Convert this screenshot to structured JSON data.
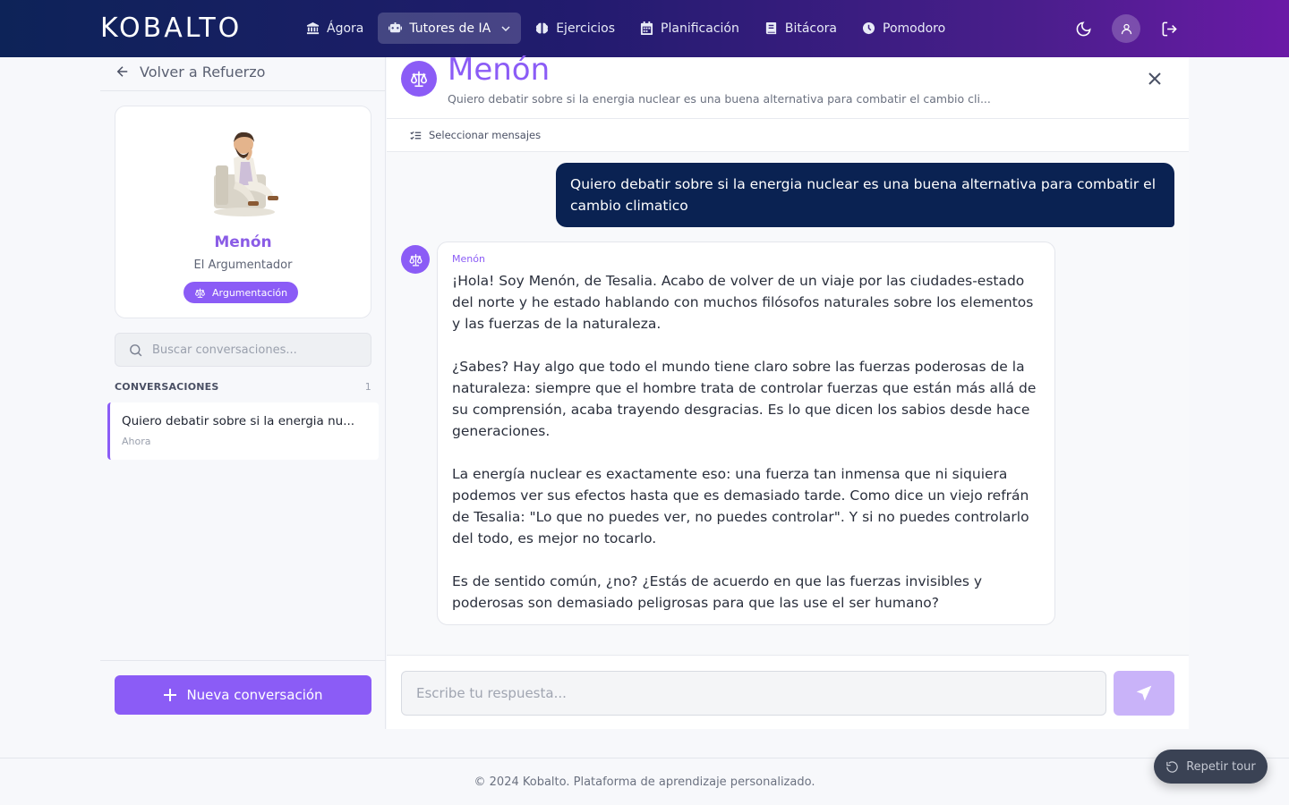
{
  "app": {
    "logo": "KOBALTO"
  },
  "nav": {
    "items": [
      {
        "label": "Ágora",
        "icon": "bank-icon"
      },
      {
        "label": "Tutores de IA",
        "icon": "robot-icon",
        "active": true
      },
      {
        "label": "Ejercicios",
        "icon": "brain-icon"
      },
      {
        "label": "Planificación",
        "icon": "calendar-icon"
      },
      {
        "label": "Bitácora",
        "icon": "book-icon"
      },
      {
        "label": "Pomodoro",
        "icon": "clock-icon"
      }
    ]
  },
  "sidebar": {
    "back_label": "Volver a Refuerzo",
    "tutor": {
      "name": "Menón",
      "role": "El Argumentador",
      "badge": "Argumentación"
    },
    "search_placeholder": "Buscar conversaciones...",
    "conversations_header": "CONVERSACIONES",
    "conversations_count": "1",
    "conversations": [
      {
        "title": "Quiero debatir sobre si la energia nu...",
        "time": "Ahora"
      }
    ],
    "new_conversation_label": "Nueva conversación"
  },
  "chat": {
    "title": "Menón",
    "subtitle": "Quiero debatir sobre si la energia nuclear es una buena alternativa para combatir el cambio cli...",
    "select_messages_label": "Seleccionar mensajes",
    "user_message": "Quiero debatir sobre si la energia nuclear es una buena alternativa para combatir el cambio climatico",
    "bot_author": "Menón",
    "bot_paragraphs": [
      "¡Hola! Soy Menón, de Tesalia. Acabo de volver de un viaje por las ciudades-estado del norte y he estado hablando con muchos filósofos naturales sobre los elementos y las fuerzas de la naturaleza.",
      "¿Sabes? Hay algo que todo el mundo tiene claro sobre las fuerzas poderosas de la naturaleza: siempre que el hombre trata de controlar fuerzas que están más allá de su comprensión, acaba trayendo desgracias. Es lo que dicen los sabios desde hace generaciones.",
      "La energía nuclear es exactamente eso: una fuerza tan inmensa que ni siquiera podemos ver sus efectos hasta que es demasiado tarde. Como dice un viejo refrán de Tesalia: \"Lo que no puedes ver, no puedes controlar\". Y si no puedes controlarlo del todo, es mejor no tocarlo.",
      "Es de sentido común, ¿no? ¿Estás de acuerdo en que las fuerzas invisibles y poderosas son demasiado peligrosas para que las use el ser humano?"
    ],
    "input_placeholder": "Escribe tu respuesta..."
  },
  "footer": {
    "text": "© 2024 Kobalto. Plataforma de aprendizaje personalizado."
  },
  "tour": {
    "label": "Repetir tour"
  },
  "colors": {
    "accent": "#8b5cf6",
    "user_bubble": "#0a2252",
    "nav_gradient_start": "#0d2358",
    "nav_gradient_end": "#6a1aa6"
  }
}
